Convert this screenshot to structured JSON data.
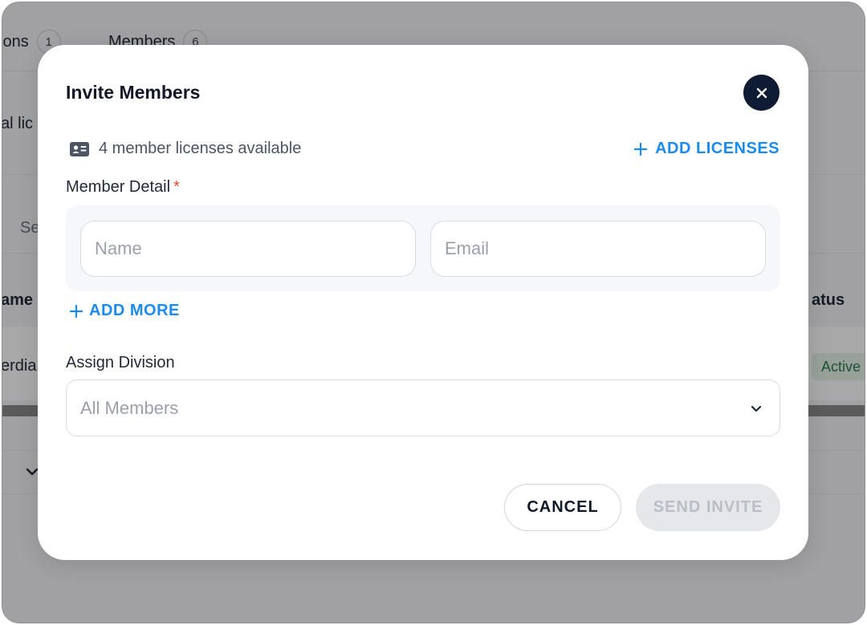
{
  "background": {
    "tabs": [
      {
        "label": "ions",
        "count": "1"
      },
      {
        "label": "Members",
        "count": "6"
      }
    ],
    "text_fragment_1": "al lic",
    "search_fragment": "Se",
    "column_name_fragment": "ame",
    "column_status_fragment": "atus",
    "row_name_fragment": "erdia",
    "row_status": "Active"
  },
  "modal": {
    "title": "Invite Members",
    "close_icon": "close-icon",
    "licenses_text": "4 member licenses available",
    "add_licenses_label": "ADD LICENSES",
    "member_detail_label": "Member Detail",
    "required_mark": "*",
    "name_placeholder": "Name",
    "email_placeholder": "Email",
    "add_more_label": "ADD MORE",
    "assign_division_label": "Assign Division",
    "division_value": "All Members",
    "cancel_label": "CANCEL",
    "send_label": "SEND INVITE"
  },
  "colors": {
    "accent": "#1a8cf0",
    "close_button": "#0f1b33",
    "required": "#e5482d",
    "disabled_button": "#e5e7eb"
  }
}
